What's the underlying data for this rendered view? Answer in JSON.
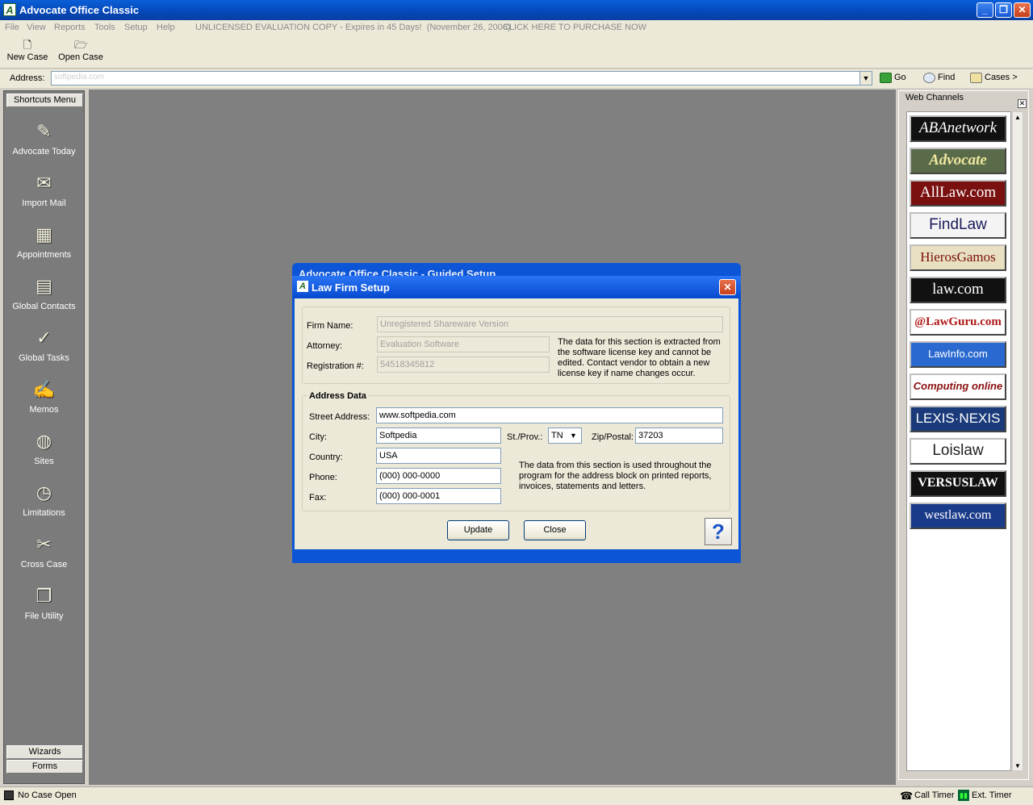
{
  "app": {
    "title": "Advocate Office Classic",
    "icon_letter": "A"
  },
  "menu": {
    "items": [
      "File",
      "View",
      "Reports",
      "Tools",
      "Setup",
      "Help"
    ],
    "notice": "UNLICENSED EVALUATION COPY - Expires in 45 Days!  (November 26, 2006)",
    "purchase": "CLICK HERE TO PURCHASE NOW"
  },
  "toolbar": {
    "new_case": "New Case",
    "open_case": "Open Case"
  },
  "address": {
    "label": "Address:",
    "value": "softpedia.com",
    "go": "Go",
    "find": "Find",
    "cases": "Cases >"
  },
  "sidebar": {
    "header": "Shortcuts Menu",
    "items": [
      {
        "label": "Advocate Today",
        "icon": "newspaper-icon"
      },
      {
        "label": "Import Mail",
        "icon": "mail-import-icon"
      },
      {
        "label": "Appointments",
        "icon": "calendar-icon"
      },
      {
        "label": "Global Contacts",
        "icon": "contacts-icon"
      },
      {
        "label": "Global Tasks",
        "icon": "tasks-icon"
      },
      {
        "label": "Memos",
        "icon": "memo-icon"
      },
      {
        "label": "Sites",
        "icon": "globe-icon"
      },
      {
        "label": "Limitations",
        "icon": "clock-icon"
      },
      {
        "label": "Cross Case",
        "icon": "cross-case-icon"
      },
      {
        "label": "File Utility",
        "icon": "folders-icon"
      }
    ],
    "wizards": "Wizards",
    "forms": "Forms"
  },
  "web_channels": {
    "title": "Web Channels",
    "channels": [
      {
        "label": "ABAnetwork",
        "bg": "#111111",
        "fg": "#ffffff"
      },
      {
        "label": "Advocate",
        "bg": "#5a6b4a",
        "fg": "#f0e8a0"
      },
      {
        "label": "AllLaw.com",
        "bg": "#7a1010",
        "fg": "#ffffff"
      },
      {
        "label": "FindLaw",
        "bg": "#f4f4f4",
        "fg": "#1a1a5a"
      },
      {
        "label": "HierosGamos",
        "bg": "#e8e0c0",
        "fg": "#7a1010"
      },
      {
        "label": "law.com",
        "bg": "#111111",
        "fg": "#ffffff"
      },
      {
        "label": "@LawGuru.com",
        "bg": "#ffffff",
        "fg": "#b01818"
      },
      {
        "label": "LawInfo.com",
        "bg": "#2a6ad0",
        "fg": "#ffffff"
      },
      {
        "label": "Computing online",
        "bg": "#ffffff",
        "fg": "#8a1010"
      },
      {
        "label": "LEXIS·NEXIS",
        "bg": "#1a3a7a",
        "fg": "#ffffff"
      },
      {
        "label": "Loislaw",
        "bg": "#ffffff",
        "fg": "#222222"
      },
      {
        "label": "VERSUSLAW",
        "bg": "#111111",
        "fg": "#ffffff"
      },
      {
        "label": "westlaw.com",
        "bg": "#1a3a8a",
        "fg": "#ffffff"
      }
    ]
  },
  "dialog_behind": {
    "title": "Advocate Office Classic - Guided Setup"
  },
  "dialog": {
    "title": "Law Firm Setup",
    "firm_name_label": "Firm Name:",
    "firm_name": "Unregistered Shareware Version",
    "attorney_label": "Attorney:",
    "attorney": "Evaluation Software",
    "registration_label": "Registration #:",
    "registration": "54518345812",
    "license_note": "The data for this section is extracted from the software license key and cannot be edited. Contact vendor to obtain a new license key if name changes occur.",
    "address_group": "Address Data",
    "street_label": "Street Address:",
    "street": "www.softpedia.com",
    "city_label": "City:",
    "city": "Softpedia",
    "state_label": "St./Prov.:",
    "state": "TN",
    "zip_label": "Zip/Postal:",
    "zip": "37203",
    "country_label": "Country:",
    "country": "USA",
    "phone_label": "Phone:",
    "phone": "(000) 000-0000",
    "fax_label": "Fax:",
    "fax": "(000) 000-0001",
    "address_note": "The data from this section is used throughout the program for the address block on printed reports, invoices, statements and letters.",
    "update": "Update",
    "close": "Close",
    "help_glyph": "?"
  },
  "status": {
    "case": "No Case Open",
    "call_timer": "Call Timer",
    "ext_timer": "Ext. Timer"
  }
}
